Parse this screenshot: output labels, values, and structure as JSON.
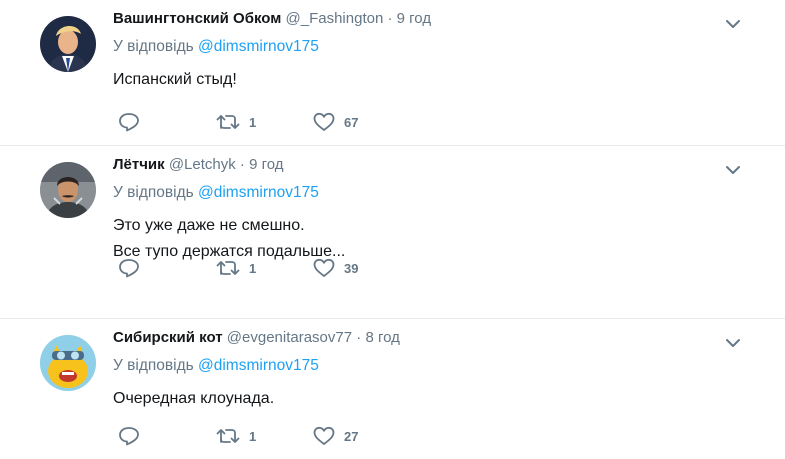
{
  "colors": {
    "link": "#1da1f2",
    "secondary": "#657786",
    "text": "#14171a",
    "divider": "#e6ecf0"
  },
  "tweets": [
    {
      "name": "Вашингтонский Обком",
      "handle": "@_Fashington",
      "dot": "·",
      "time": "9 год",
      "reply_prefix": "У відповідь",
      "reply_to": "@dimsmirnov175",
      "lines": [
        "Испанский стыд!"
      ],
      "retweets": "1",
      "likes": "67"
    },
    {
      "name": "Лётчик",
      "handle": "@Letchyk",
      "dot": "·",
      "time": "9 год",
      "reply_prefix": "У відповідь",
      "reply_to": "@dimsmirnov175",
      "lines": [
        "Это уже даже не смешно.",
        "Все тупо держатся подальше..."
      ],
      "retweets": "1",
      "likes": "39"
    },
    {
      "name": "Сибирский кот",
      "handle": "@evgenitarasov77",
      "dot": "·",
      "time": "8 год",
      "reply_prefix": "У відповідь",
      "reply_to": "@dimsmirnov175",
      "lines": [
        "Очередная клоунада."
      ],
      "retweets": "1",
      "likes": "27"
    }
  ]
}
